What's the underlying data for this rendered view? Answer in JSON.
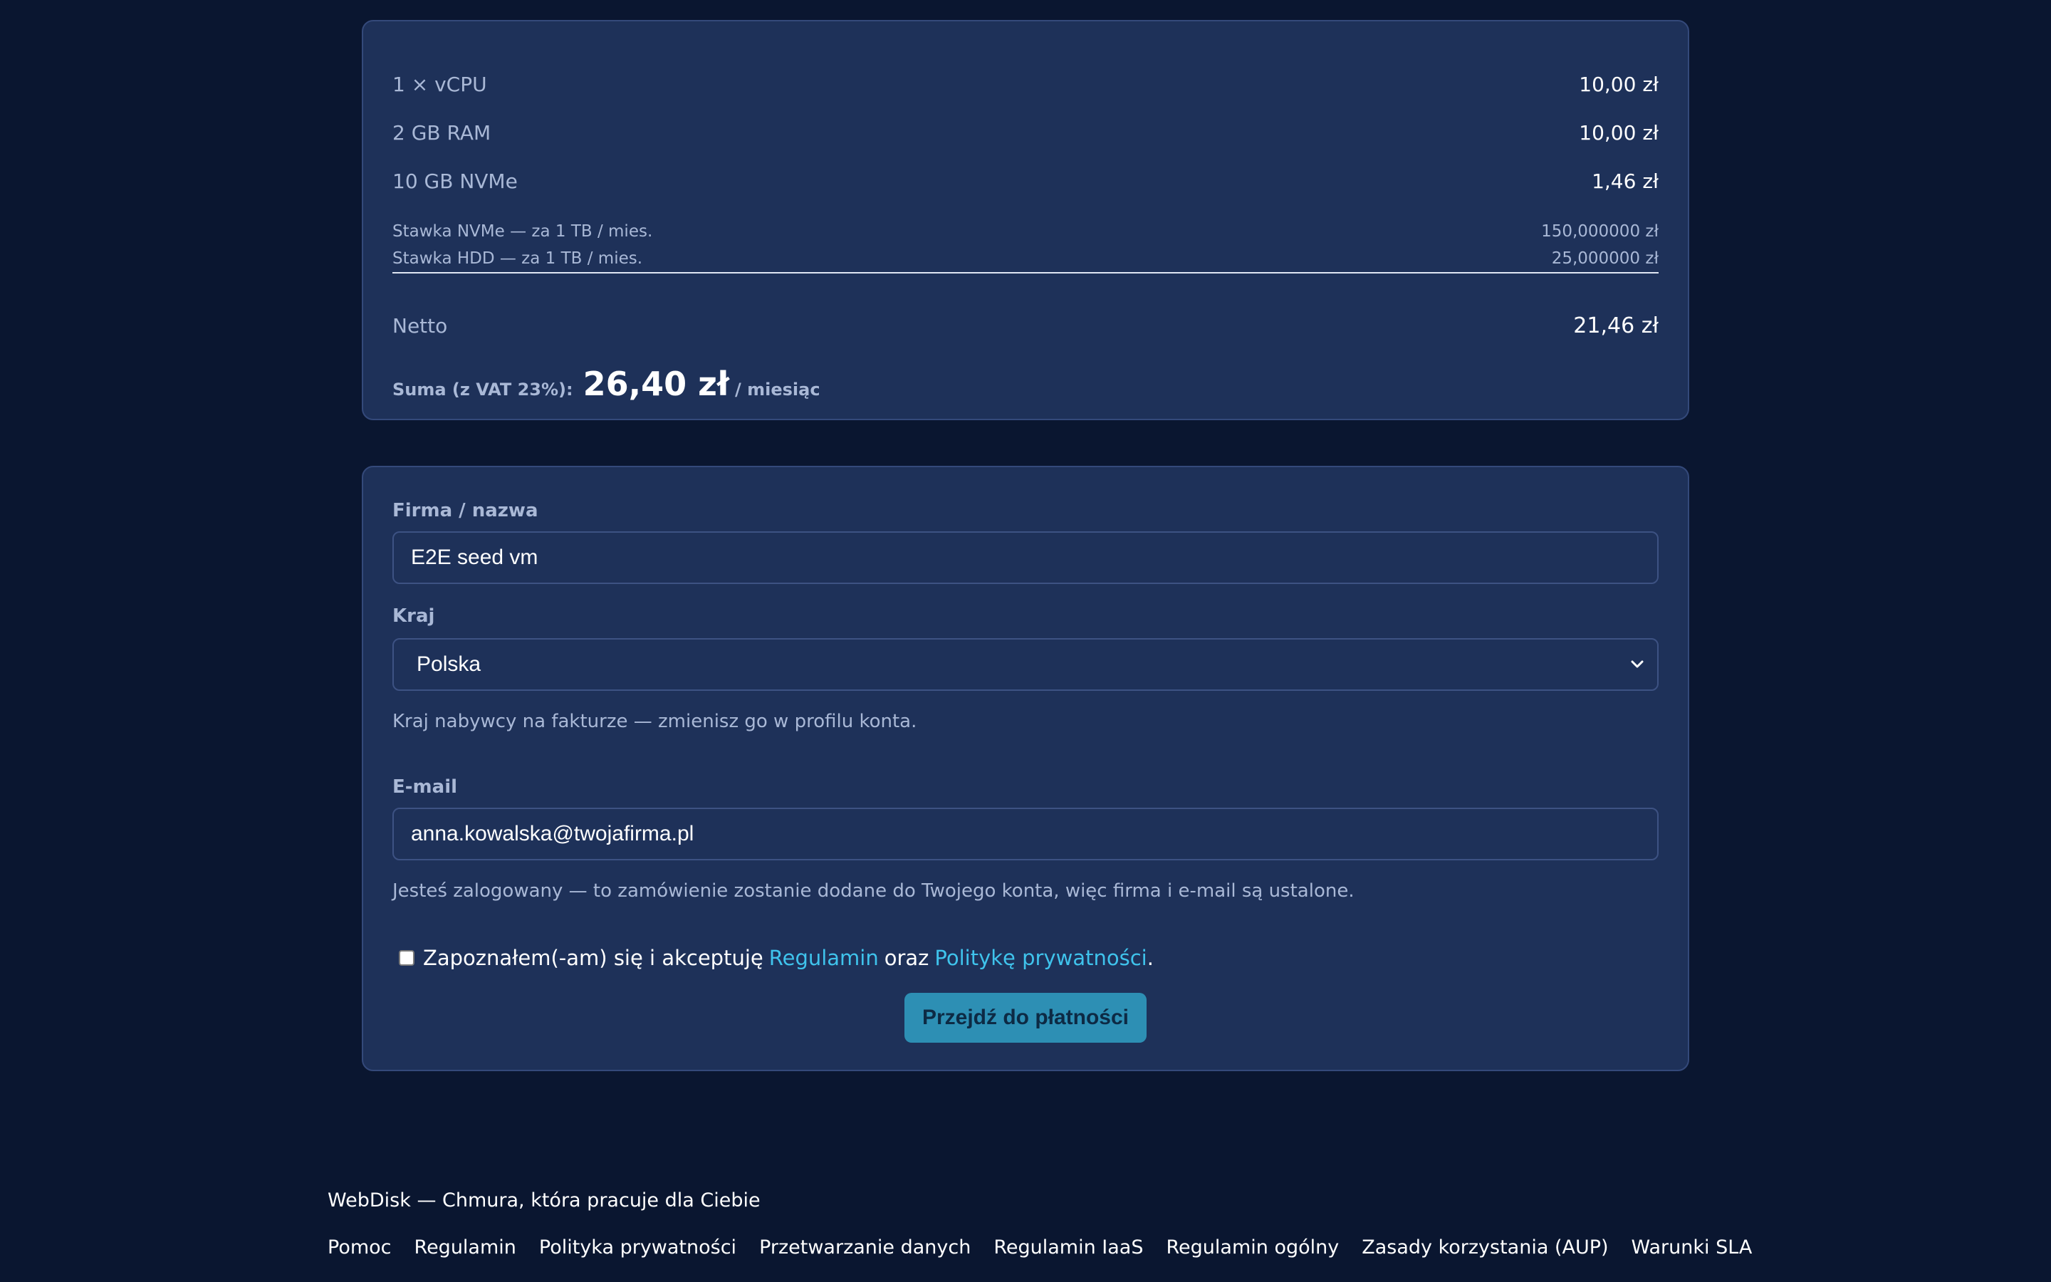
{
  "summary": {
    "lines": [
      {
        "label": "1 × vCPU",
        "value": "10,00 zł"
      },
      {
        "label": "2 GB RAM",
        "value": "10,00 zł"
      },
      {
        "label": "10 GB NVMe",
        "value": "1,46 zł"
      }
    ],
    "rates": [
      {
        "label": "Stawka NVMe — za 1 TB / mies.",
        "value": "150,000000 zł"
      },
      {
        "label": "Stawka HDD — za 1 TB / mies.",
        "value": "25,000000 zł"
      }
    ],
    "netto_label": "Netto",
    "netto_value": "21,46 zł",
    "total_label": "Suma (z VAT 23%):",
    "total_amount": "26,40 zł",
    "total_period": "/ miesiąc"
  },
  "form": {
    "company_label": "Firma / nazwa",
    "company_value": "E2E seed vm",
    "country_label": "Kraj",
    "country_value": "Polska",
    "country_help": "Kraj nabywcy na fakturze — zmienisz go w profilu konta.",
    "email_label": "E-mail",
    "email_value": "anna.kowalska@twojafirma.pl",
    "logged_in_help": "Jesteś zalogowany — to zamówienie zostanie dodane do Twojego konta, więc firma i e-mail są ustalone.",
    "consent_prefix": "Zapoznałem(-am) się i akceptuję",
    "consent_terms_link": "Regulamin",
    "consent_mid": "oraz",
    "consent_privacy_link": "Politykę prywatności",
    "consent_suffix": ".",
    "consent_checked": false,
    "submit_label": "Przejdź do płatności"
  },
  "footer": {
    "tagline": "WebDisk — Chmura, która pracuje dla Ciebie",
    "links": [
      "Pomoc",
      "Regulamin",
      "Polityka prywatności",
      "Przetwarzanie danych",
      "Regulamin IaaS",
      "Regulamin ogólny",
      "Zasady korzystania (AUP)",
      "Warunki SLA"
    ]
  },
  "colors": {
    "background": "#0a1630",
    "card": "#1e3159",
    "accent_link": "#3fc3ec",
    "button": "#2d8fb4"
  }
}
